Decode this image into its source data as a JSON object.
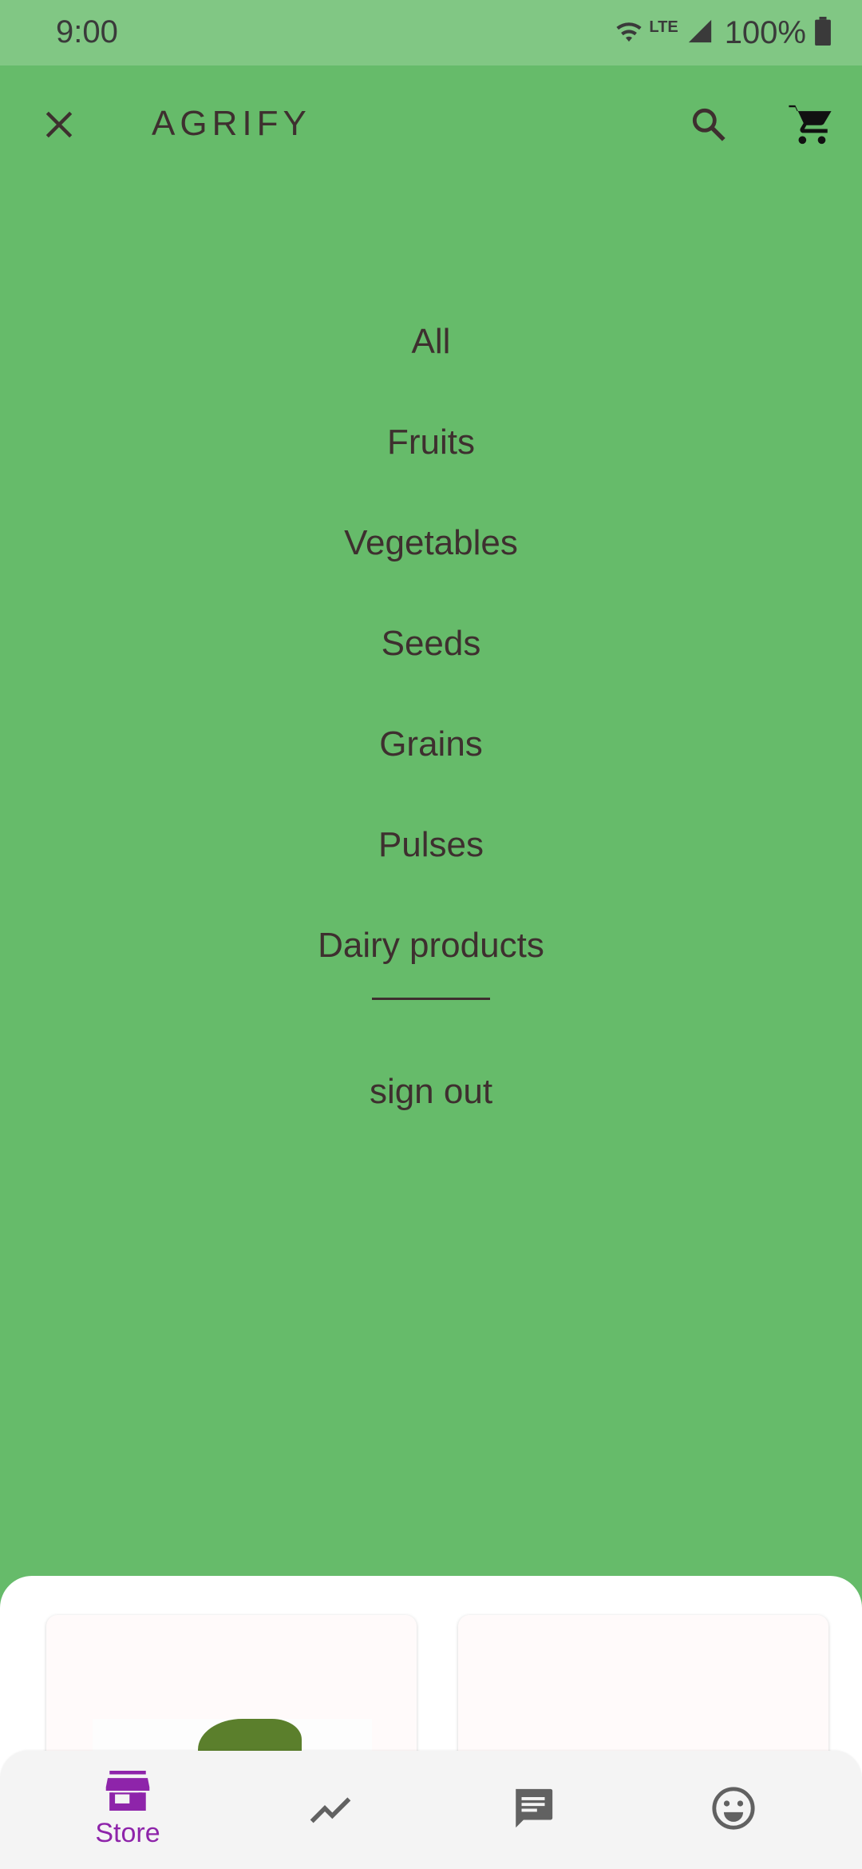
{
  "status_bar": {
    "time": "9:00",
    "network": "LTE",
    "battery": "100%",
    "icons": [
      "wifi-icon",
      "signal-icon",
      "battery-icon"
    ]
  },
  "app_bar": {
    "title": "AGRIFY",
    "icons": [
      "close-icon",
      "search-icon",
      "cart-icon"
    ]
  },
  "menu": {
    "items": [
      "All",
      "Fruits",
      "Vegetables",
      "Seeds",
      "Grains",
      "Pulses",
      "Dairy products"
    ],
    "sign_out": "sign out"
  },
  "bottom_nav": {
    "items": [
      {
        "icon": "store-icon",
        "label": "Store",
        "active": true
      },
      {
        "icon": "trending-icon",
        "label": "",
        "active": false
      },
      {
        "icon": "chat-icon",
        "label": "",
        "active": false
      },
      {
        "icon": "emoji-icon",
        "label": "",
        "active": false
      }
    ]
  },
  "colors": {
    "background": "#66bb6a",
    "status_bar": "#81c784",
    "text": "#3e2f2f",
    "accent": "#8e24aa",
    "nav_icon": "#616161"
  }
}
